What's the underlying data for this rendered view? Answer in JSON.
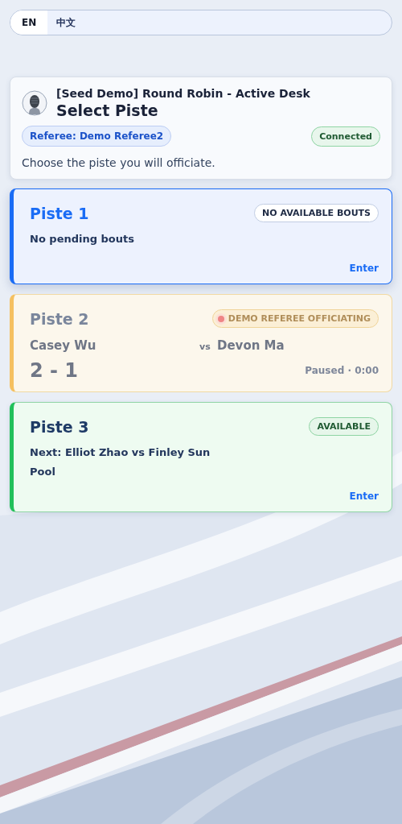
{
  "language_switch": [
    {
      "label": "EN",
      "selected": true
    },
    {
      "label": "中文",
      "selected": false
    }
  ],
  "header": {
    "event": "[Seed Demo] Round Robin - Active Desk",
    "title": "Select Piste",
    "referee": "Referee: Demo Referee2",
    "connection": "Connected",
    "instruction": "Choose the piste you will officiate."
  },
  "pistes": [
    {
      "kind": "empty",
      "selected": true,
      "name": "Piste 1",
      "status": "NO AVAILABLE BOUTS",
      "message": "No pending bouts",
      "action": "Enter"
    },
    {
      "kind": "in_progress",
      "selected": false,
      "name": "Piste 2",
      "status": "DEMO REFEREE OFFICIATING",
      "fencer_left": "Casey Wu",
      "vs": "vs",
      "fencer_right": "Devon Ma",
      "score": "2 - 1",
      "clock": "Paused · 0:00"
    },
    {
      "kind": "available",
      "selected": false,
      "name": "Piste 3",
      "status": "AVAILABLE",
      "next": "Next: Elliot Zhao vs Finley Sun",
      "round": "Pool",
      "action": "Enter"
    }
  ]
}
